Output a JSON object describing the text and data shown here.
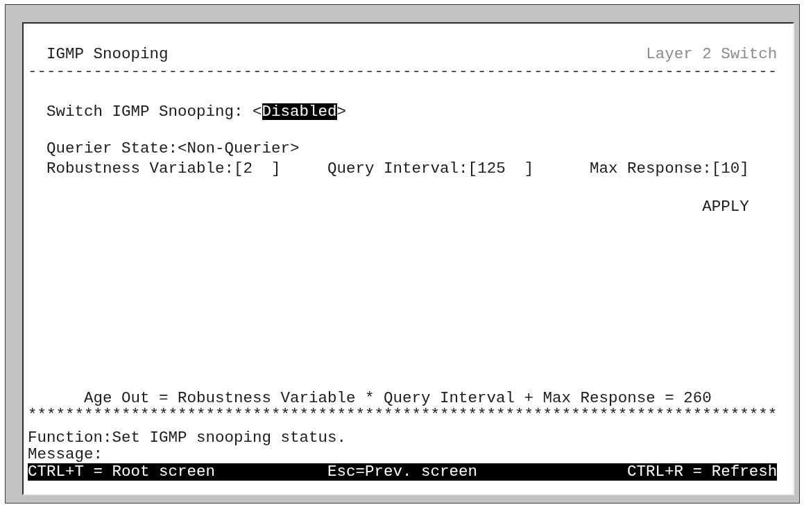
{
  "header": {
    "title": "IGMP Snooping",
    "device": "Layer 2 Switch",
    "rule": "--------------------------------------------------------------------------------"
  },
  "form": {
    "rows": [
      {
        "fields": [
          {
            "kind": "toggle",
            "label": "Switch IGMP Snooping:",
            "delimiters": [
              "<",
              ">"
            ],
            "value": "Disabled",
            "selected": true
          }
        ]
      },
      {
        "fields": [
          {
            "kind": "state",
            "label": "Querier State:",
            "delimiters": [
              "<",
              ">"
            ],
            "value": "Non-Querier",
            "selected": false
          }
        ]
      },
      {
        "fields": [
          {
            "kind": "number",
            "label": "Robustness Variable:",
            "delimiters": [
              "[",
              "]"
            ],
            "value": "2",
            "selected": false
          },
          {
            "kind": "number",
            "label": "Query Interval:",
            "delimiters": [
              "[",
              "]"
            ],
            "value": "125",
            "selected": false
          },
          {
            "kind": "number",
            "label": "Max Response:",
            "delimiters": [
              "[",
              "]"
            ],
            "value": "10",
            "selected": false
          }
        ]
      }
    ]
  },
  "apply": {
    "label": "APPLY",
    "selected": false
  },
  "formula": "Age Out = Robustness Variable * Query Interval + Max Response = 260",
  "footer_rule": "********************************************************************************",
  "function": {
    "label": "Function:",
    "text": "Set IGMP snooping status."
  },
  "message": {
    "label": "Message:"
  },
  "hotkeys": [
    "CTRL+T = Root screen",
    "Esc=Prev. screen",
    "CTRL+R = Refresh"
  ]
}
